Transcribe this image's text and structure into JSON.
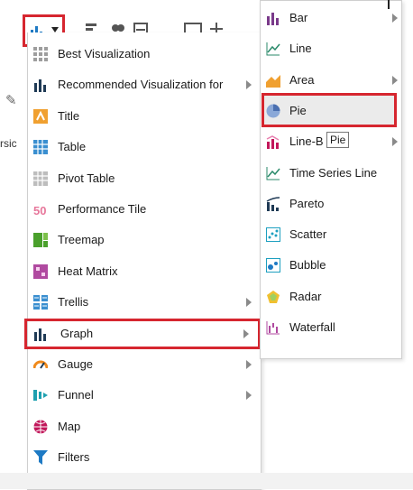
{
  "colors": {
    "highlight_border": "#d6262f",
    "graph_icon": "#1f3a55",
    "accent_blue": "#1e7ac4",
    "pie_icon": "#6f90c8"
  },
  "edge": {
    "left_text": "rsic"
  },
  "menu": {
    "items": [
      {
        "label": "Best Visualization",
        "icon": "grid-icon",
        "has_submenu": false
      },
      {
        "label": "Recommended Visualization for",
        "icon": "graph-bars-icon",
        "has_submenu": true
      },
      {
        "label": "Title",
        "icon": "title-icon",
        "has_submenu": false
      },
      {
        "label": "Table",
        "icon": "table-icon",
        "has_submenu": false
      },
      {
        "label": "Pivot Table",
        "icon": "pivot-table-icon",
        "has_submenu": false
      },
      {
        "label": "Performance Tile",
        "icon": "performance-tile-icon",
        "has_submenu": false,
        "icon_text": "50"
      },
      {
        "label": "Treemap",
        "icon": "treemap-icon",
        "has_submenu": false
      },
      {
        "label": "Heat Matrix",
        "icon": "heat-matrix-icon",
        "has_submenu": false
      },
      {
        "label": "Trellis",
        "icon": "trellis-icon",
        "has_submenu": true
      },
      {
        "label": "Graph",
        "icon": "graph-icon",
        "has_submenu": true,
        "highlighted": true
      },
      {
        "label": "Gauge",
        "icon": "gauge-icon",
        "has_submenu": true
      },
      {
        "label": "Funnel",
        "icon": "funnel-icon",
        "has_submenu": true
      },
      {
        "label": "Map",
        "icon": "map-icon",
        "has_submenu": false
      },
      {
        "label": "Filters",
        "icon": "filter-icon",
        "has_submenu": false
      }
    ]
  },
  "submenu": {
    "items": [
      {
        "label": "Bar",
        "icon": "bar-chart-icon",
        "has_submenu": true
      },
      {
        "label": "Line",
        "icon": "line-chart-icon",
        "has_submenu": false
      },
      {
        "label": "Area",
        "icon": "area-chart-icon",
        "has_submenu": true
      },
      {
        "label": "Pie",
        "icon": "pie-chart-icon",
        "has_submenu": false,
        "highlighted": true
      },
      {
        "label": "Line-B",
        "icon": "line-bar-chart-icon",
        "has_submenu": true
      },
      {
        "label": "Time Series Line",
        "icon": "time-series-icon",
        "has_submenu": false
      },
      {
        "label": "Pareto",
        "icon": "pareto-icon",
        "has_submenu": false
      },
      {
        "label": "Scatter",
        "icon": "scatter-icon",
        "has_submenu": false
      },
      {
        "label": "Bubble",
        "icon": "bubble-icon",
        "has_submenu": false
      },
      {
        "label": "Radar",
        "icon": "radar-icon",
        "has_submenu": false
      },
      {
        "label": "Waterfall",
        "icon": "waterfall-icon",
        "has_submenu": false
      }
    ],
    "tooltip": "Pie"
  }
}
